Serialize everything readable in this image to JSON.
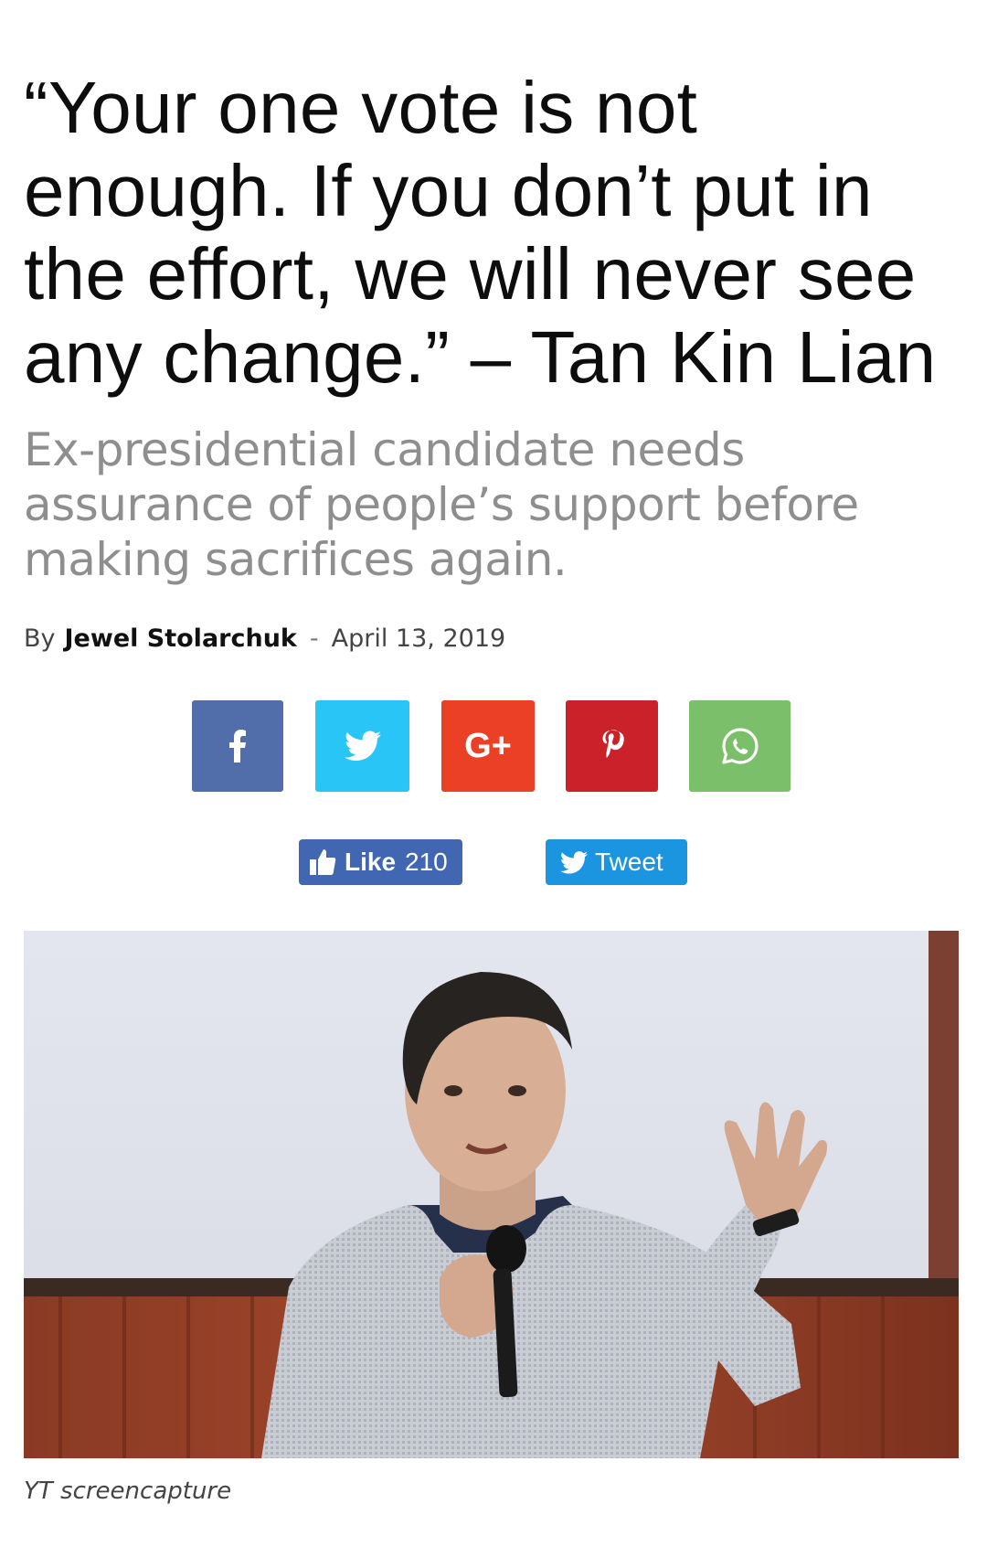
{
  "article": {
    "headline": "“Your one vote is not enough. If you don’t put in the effort, we will never see any change.” – Tan Kin Lian",
    "subtitle": "Ex-presidential candidate needs assurance of people’s support before making sacrifices again.",
    "byline": {
      "prefix": "By",
      "author": "Jewel Stolarchuk",
      "separator": "-",
      "date": "April 13, 2019"
    }
  },
  "share_buttons": [
    {
      "network": "facebook",
      "icon": "facebook-icon",
      "color": "#516eab"
    },
    {
      "network": "twitter",
      "icon": "twitter-icon",
      "color": "#29c5f6"
    },
    {
      "network": "google-plus",
      "icon": "google-plus-icon",
      "label": "G+",
      "color": "#eb4026"
    },
    {
      "network": "pinterest",
      "icon": "pinterest-icon",
      "color": "#ca212a"
    },
    {
      "network": "whatsapp",
      "icon": "whatsapp-icon",
      "color": "#7bbf6a"
    }
  ],
  "social": {
    "like_label": "Like",
    "like_count": "210",
    "tweet_label": "Tweet",
    "like_color": "#4267b2",
    "tweet_color": "#1b95e0"
  },
  "image": {
    "caption": "YT screencapture"
  }
}
